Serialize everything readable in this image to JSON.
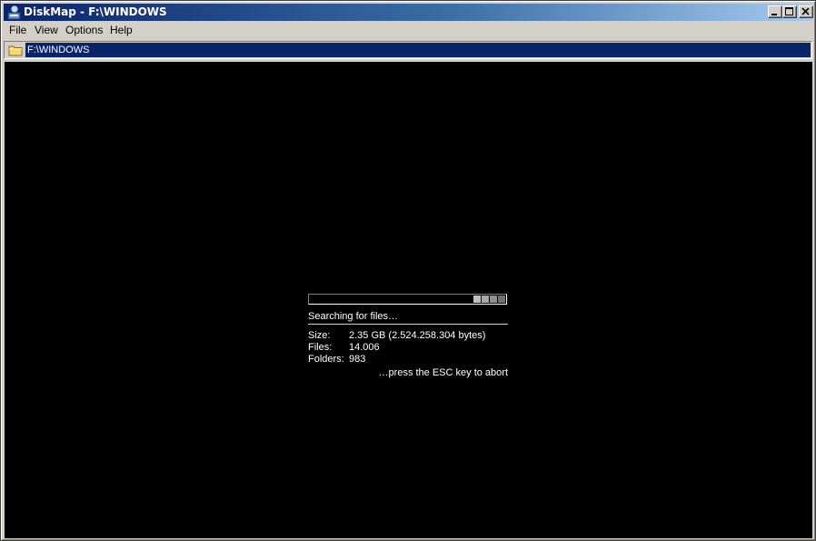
{
  "window": {
    "title": "DiskMap - F:\\WINDOWS"
  },
  "menu": [
    "File",
    "View",
    "Options",
    "Help"
  ],
  "path": {
    "value": "F:\\WINDOWS"
  },
  "scan": {
    "status": "Searching for files…",
    "size_label": "Size:",
    "size_value": "2.35 GB (2.524.258.304 bytes)",
    "files_label": "Files:",
    "files_value": "14.006",
    "folders_label": "Folders:",
    "folders_value": "983",
    "abort_hint": "…press the ESC key to abort"
  },
  "colors": {
    "title_gradient_start": "#0a246a",
    "title_gradient_end": "#a6caf0",
    "canvas": "#000000",
    "chrome": "#d4d0c8",
    "progress_blocks": [
      "#c0c0c0",
      "#a0a0a0",
      "#808080",
      "#606060"
    ]
  }
}
